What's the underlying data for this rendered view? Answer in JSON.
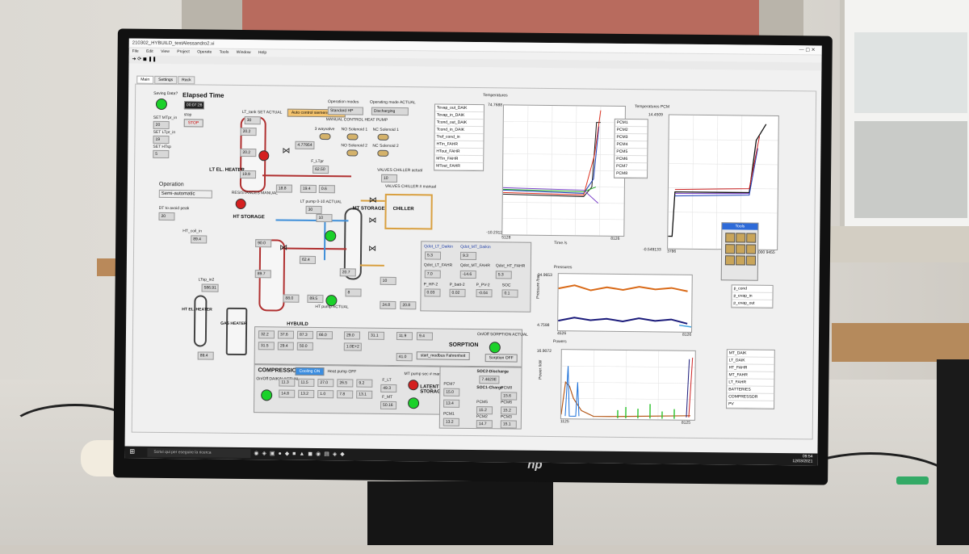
{
  "monitor": {
    "brand": "hp"
  },
  "window": {
    "title": "210302_HYBUILD_testAlessandro2.vi"
  },
  "menu": [
    "File",
    "Edit",
    "View",
    "Project",
    "Operate",
    "Tools",
    "Window",
    "Help"
  ],
  "tabs": [
    "Main",
    "Settings",
    "Rack"
  ],
  "left_panel": {
    "saving_data": "Saving Data?",
    "elapsed_label": "Elapsed Time",
    "elapsed_value": "00:07:26",
    "stop": "STOP",
    "stop_label": "stop",
    "set_mt_in": "SET MTpr_in",
    "set_mt_in_val": "20",
    "set_lt_in": "SET LTpr_in",
    "set_lt_in_val": "19",
    "set_htsp": "SET HTsp",
    "set_htsp_val": "5",
    "operation_label": "Operation",
    "operation_value": "Semi-automatic",
    "dt_label": "DT to avoid peak",
    "dt_value": "20",
    "ht_coil_in": "HT_coil_in",
    "ht_coil_val": "89.4",
    "lt_sp": "LTsp_in2",
    "lt_sp_val": "586.91"
  },
  "schematic": {
    "lt_tank_set": "LT_tank SET ACTUAL",
    "lt_tank_val": "30",
    "auto_control": "Auto control siemens valves",
    "op_modes": "Operation modes",
    "op_mode_val": "Standard HP",
    "op_mode_actual": "Operating mode ACTUAL",
    "op_mode_actual_val": "Discharging",
    "manual_hp": "MANUAL CONTROL HEAT PUMP",
    "three_way": "3 wayvalve",
    "no_sol1": "NO Solenoid 1",
    "nc_sol1": "NC Solenoid 1",
    "no_sol2": "NO Solenoid 2",
    "nc_sol2": "NC Solenoid 2",
    "lt_el_heater": "LT EL. HEATER",
    "ht_storage": "HT STORAGE",
    "mt_storage": "MT STORAGE",
    "chiller": "CHILLER",
    "valves_chiller_actual": "VALVES CHILLER actual",
    "valves_chiller_actual_val": "10",
    "valves_chiller_manual": "VALVES CHILLER # manual",
    "resistances": "RESISTANCES MANUAL",
    "lt_pump": "LT pump 0-10 ACTUAL",
    "ht_el_heater": "HT EL. HEATER",
    "gas_heater": "GAS HEATER",
    "f_ltpr": "F_LTpr",
    "f_ltpr_val": "62.50",
    "lt_vals": [
      "20.2",
      "20.2",
      "19.9",
      "18.8",
      "19.4",
      "0.6",
      "30",
      "10"
    ],
    "ht_vals": [
      "90.0",
      "89.7",
      "62.4",
      "88.0",
      "89.5",
      "89.4",
      "20.7",
      "10"
    ],
    "mt_vals": [
      "24.8",
      "20.8",
      "8",
      "4.77954"
    ],
    "ht_pump_actual": "HT pump ACTUAL",
    "hybuild": "HYBUILD"
  },
  "daikin_box": {
    "labels": [
      "Qdot_LT_Daikin",
      "Qdot_MT_Daikin",
      "Qdot_LT_FAHR",
      "Qdot_MT_FAHR",
      "Qdot_HT_FAHR",
      "P_HP-2",
      "P_batt-2",
      "P_PV-2",
      "SOC"
    ],
    "values": [
      "5.3",
      "9.3",
      "7.0",
      "-14.6",
      "5.3",
      "0.03",
      "0.02",
      "-0.04",
      "0.1"
    ]
  },
  "bottom": {
    "sorption": "SORPTION",
    "sorption_btn": "Sorption OFF",
    "on_off_sorption": "On/Off SORPTION ACTUAL",
    "modbus": "start_modbus Fahrenheit",
    "compression": "COMPRESSION",
    "cooling_btn": "Cooling ON",
    "hp_off": "Heat pump OFF",
    "on_off_daikin": "On/Off DAIKIN ACTUAL",
    "latent": "LATENT STORAGE",
    "mt_pump": "MT pump sec # manual",
    "soc2": "SOC2-Discharge",
    "soc2_val": "7.4623E",
    "soc1": "SOC1-Charge",
    "pcm": [
      "PCM7",
      "PCM8",
      "PCM5",
      "PCM6",
      "PCM1",
      "PCM2",
      "PCM3",
      "PCM4"
    ],
    "pcm_vals": [
      "15.0",
      "15.6",
      "15.2",
      "15.2",
      "13.4",
      "14.7",
      "13.2",
      "15.1"
    ],
    "f_lt": "F_LT",
    "f_lt_val": "49.3",
    "f_mt": "F_MT",
    "f_mt_val": "50.16",
    "grid_vals": [
      "32.2",
      "37.6",
      "87.3",
      "66.0",
      "29.0",
      "31.1",
      "11.9",
      "9.4",
      "31.5",
      "29.4",
      "50.0",
      "1.0E+2",
      "41.0"
    ],
    "comp_vals": [
      "11.3",
      "11.5",
      "27.0",
      "26.5",
      "9.2",
      "14.8",
      "13.2",
      "1.0",
      "7.8",
      "13.1"
    ]
  },
  "charts": {
    "temps_title": "Temperatures",
    "temps_ymax": "74.7688",
    "temps_ymin": "-10.2312",
    "temps_xmin": "5128",
    "temps_xmax": "8126",
    "temps_xlabel": "Time /s",
    "temps_legend": [
      "Tevap_out_DAIK",
      "Tevap_in_DAIK",
      "Tcond_out_DAIK",
      "Tcond_in_DAIK",
      "Tref_cond_in",
      "HTin_FAHR",
      "HTout_FAHR",
      "MTin_FAHR",
      "MTout_FAHR"
    ],
    "pcm_title": "Temperatures PCM",
    "pcm_ymax": "14.4509",
    "pcm_ymin": "-0.549133",
    "pcm_xmin": "3786",
    "pcm_xmax": "9000 9455",
    "pcm_legend": [
      "PCM1",
      "PCM2",
      "PCM3",
      "PCM4",
      "PCM5",
      "PCM6",
      "PCM7",
      "PCM8"
    ],
    "press_title": "Pressures",
    "press_ymax": "34.9653",
    "press_ymin": "4.7598",
    "press_xmin": "4526",
    "press_xmax": "8126",
    "press_ylabel": "Pressure /bar",
    "press_legend": [
      "p_cond",
      "p_evap_in",
      "p_evap_out"
    ],
    "power_title": "Powers",
    "power_ymax": "16.9072",
    "power_xmin": "1125",
    "power_xmax": "8125",
    "power_ylabel": "Power /kW",
    "power_legend": [
      "MT_DAIK",
      "LT_DAIK",
      "HT_FAHR",
      "MT_FAHR",
      "LT_FAHR",
      "BATTERIES",
      "COMPRESSOR",
      "PV"
    ],
    "tools": "Tools"
  },
  "taskbar": {
    "search": "Scrivi qui per eseguire la ricerca",
    "time": "09:54",
    "date": "12/03/2021"
  }
}
